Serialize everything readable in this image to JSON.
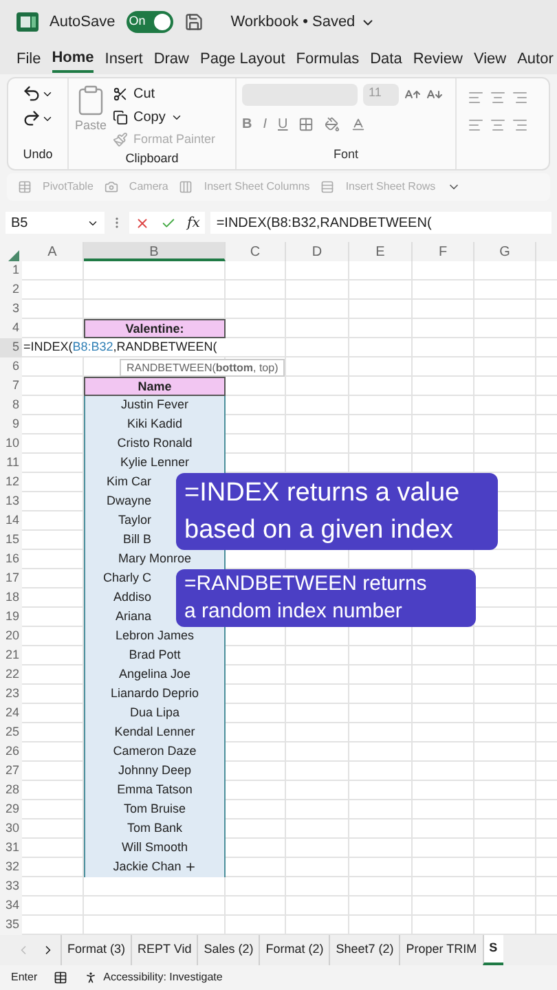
{
  "title_bar": {
    "autosave_label": "AutoSave",
    "autosave_on": true,
    "autosave_state": "On",
    "title": "Workbook • Saved"
  },
  "menu_tabs": [
    {
      "label": "File",
      "selected": false
    },
    {
      "label": "Home",
      "selected": true
    },
    {
      "label": "Insert",
      "selected": false
    },
    {
      "label": "Draw",
      "selected": false
    },
    {
      "label": "Page Layout",
      "selected": false
    },
    {
      "label": "Formulas",
      "selected": false
    },
    {
      "label": "Data",
      "selected": false
    },
    {
      "label": "Review",
      "selected": false
    },
    {
      "label": "View",
      "selected": false
    },
    {
      "label": "Autor",
      "selected": false
    }
  ],
  "ribbon": {
    "paste": "Paste",
    "cut": "Cut",
    "copy": "Copy",
    "format_painter": "Format Painter",
    "font_size": "11",
    "bold": "B",
    "italic": "I",
    "underline": "U",
    "groups": [
      "Undo",
      "Clipboard",
      "Font"
    ]
  },
  "quick_bar": [
    "PivotTable",
    "Camera",
    "Insert Sheet Columns",
    "Insert Sheet Rows"
  ],
  "formula_bar": {
    "name_box": "B5",
    "function_label": "fx",
    "formula": "=INDEX(B8:B32,RANDBETWEEN("
  },
  "grid": {
    "columns": [
      "A",
      "B",
      "C",
      "D",
      "E",
      "F",
      "G"
    ],
    "row_numbers": [
      "1",
      "2",
      "3",
      "4",
      "5",
      "6",
      "7",
      "8",
      "9",
      "10",
      "11",
      "12",
      "13",
      "14",
      "15",
      "16",
      "17",
      "18",
      "19",
      "20",
      "21",
      "22",
      "23",
      "24",
      "25",
      "26",
      "27",
      "28",
      "29",
      "30",
      "31",
      "32",
      "33",
      "34",
      "35"
    ],
    "title_cell": "Valentine:",
    "edit_formula": {
      "prefix": "=INDEX(",
      "range": "B8:B32",
      "suffix": ",RANDBETWEEN("
    },
    "tooltip": "RANDBETWEEN(**bottom**, top)",
    "name_header": "Name",
    "names": [
      {
        "text": "Justin Fever",
        "kind": "full"
      },
      {
        "text": "Kiki Kadid",
        "kind": "full"
      },
      {
        "text": "Cristo Ronald",
        "kind": "full"
      },
      {
        "text": "Kylie Lenner",
        "kind": "full"
      },
      {
        "text": "Kim Car",
        "kind": "cut"
      },
      {
        "text": "Dwayne",
        "kind": "cut"
      },
      {
        "text": "Taylor",
        "kind": "cut"
      },
      {
        "text": "Bill B",
        "kind": "cut"
      },
      {
        "text": "Mary Monroe",
        "kind": "full"
      },
      {
        "text": "Charly C",
        "kind": "cut"
      },
      {
        "text": "Addiso",
        "kind": "cut"
      },
      {
        "text": "Ariana",
        "kind": "cut"
      },
      {
        "text": "Lebron James",
        "kind": "full"
      },
      {
        "text": "Brad Pott",
        "kind": "full"
      },
      {
        "text": "Angelina Joe",
        "kind": "full"
      },
      {
        "text": "Lianardo Deprio",
        "kind": "full"
      },
      {
        "text": "Dua Lipa",
        "kind": "full"
      },
      {
        "text": "Kendal Lenner",
        "kind": "full"
      },
      {
        "text": "Cameron Daze",
        "kind": "full"
      },
      {
        "text": "Johnny Deep",
        "kind": "full"
      },
      {
        "text": "Emma Tatson",
        "kind": "full"
      },
      {
        "text": "Tom Bruise",
        "kind": "full"
      },
      {
        "text": "Tom Bank",
        "kind": "full"
      },
      {
        "text": "Will Smooth",
        "kind": "full"
      },
      {
        "text": "Jackie Chan",
        "kind": "full"
      }
    ]
  },
  "overlays": [
    {
      "lines": [
        "=INDEX returns a value",
        "based on a given index"
      ],
      "kind": "large"
    },
    {
      "lines": [
        "=RANDBETWEEN returns",
        "a random index number"
      ],
      "kind": "small"
    }
  ],
  "sheet_tabs": [
    {
      "label": "Format (3)",
      "selected": false
    },
    {
      "label": "REPT Vid",
      "selected": false
    },
    {
      "label": "Sales (2)",
      "selected": false
    },
    {
      "label": "Format (2)",
      "selected": false
    },
    {
      "label": "Sheet7 (2)",
      "selected": false
    },
    {
      "label": "Proper TRIM",
      "selected": false
    },
    {
      "label": "S",
      "selected": true
    }
  ],
  "status_bar": {
    "mode": "Enter",
    "accessibility": "Accessibility: Investigate"
  }
}
